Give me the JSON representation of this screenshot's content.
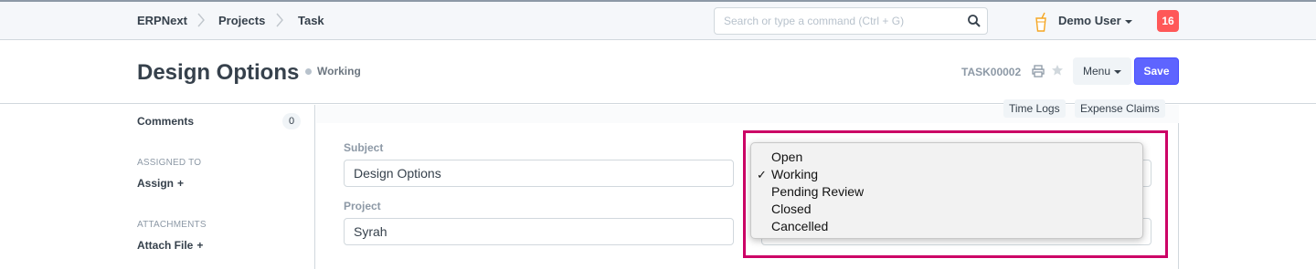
{
  "navbar": {
    "breadcrumbs": [
      "ERPNext",
      "Projects",
      "Task"
    ],
    "search_placeholder": "Search or type a command (Ctrl + G)",
    "user_name": "Demo User",
    "notification_count": "16"
  },
  "header": {
    "title": "Design Options",
    "status": "Working",
    "doc_id": "TASK00002",
    "menu_label": "Menu",
    "save_label": "Save"
  },
  "sidebar": {
    "comments_label": "Comments",
    "comments_count": "0",
    "assigned_heading": "ASSIGNED TO",
    "assign_label": "Assign",
    "attachments_heading": "ATTACHMENTS",
    "attach_label": "Attach File"
  },
  "form": {
    "link_buttons": [
      "Time Logs",
      "Expense Claims"
    ],
    "subject_label": "Subject",
    "subject_value": "Design Options",
    "project_label": "Project",
    "project_value": "Syrah"
  },
  "status_dropdown": {
    "options": [
      "Open",
      "Working",
      "Pending Review",
      "Closed",
      "Cancelled"
    ],
    "selected": "Working"
  },
  "colors": {
    "primary": "#5e64ff",
    "notification": "#ff5858",
    "highlight": "#cc0066"
  }
}
